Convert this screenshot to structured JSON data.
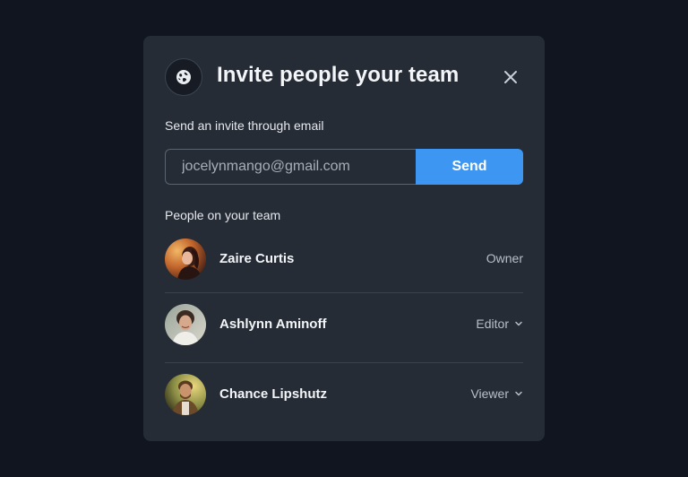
{
  "modal": {
    "title": "Invite people your team",
    "header_icon": "globe-icon",
    "close_icon": "close-icon"
  },
  "invite": {
    "label": "Send an invite through email",
    "email_value": "jocelynmango@gmail.com",
    "send_label": "Send"
  },
  "team": {
    "label": "People on your team",
    "members": [
      {
        "name": "Zaire Curtis",
        "role": "Owner",
        "has_dropdown": false
      },
      {
        "name": "Ashlynn Aminoff",
        "role": "Editor",
        "has_dropdown": true
      },
      {
        "name": "Chance Lipshutz",
        "role": "Viewer",
        "has_dropdown": true
      }
    ]
  },
  "colors": {
    "background": "#11151f",
    "modal": "#252c35",
    "accent": "#3d97f2",
    "text_primary": "#f3f5f8",
    "text_muted": "#b9bfc8"
  }
}
